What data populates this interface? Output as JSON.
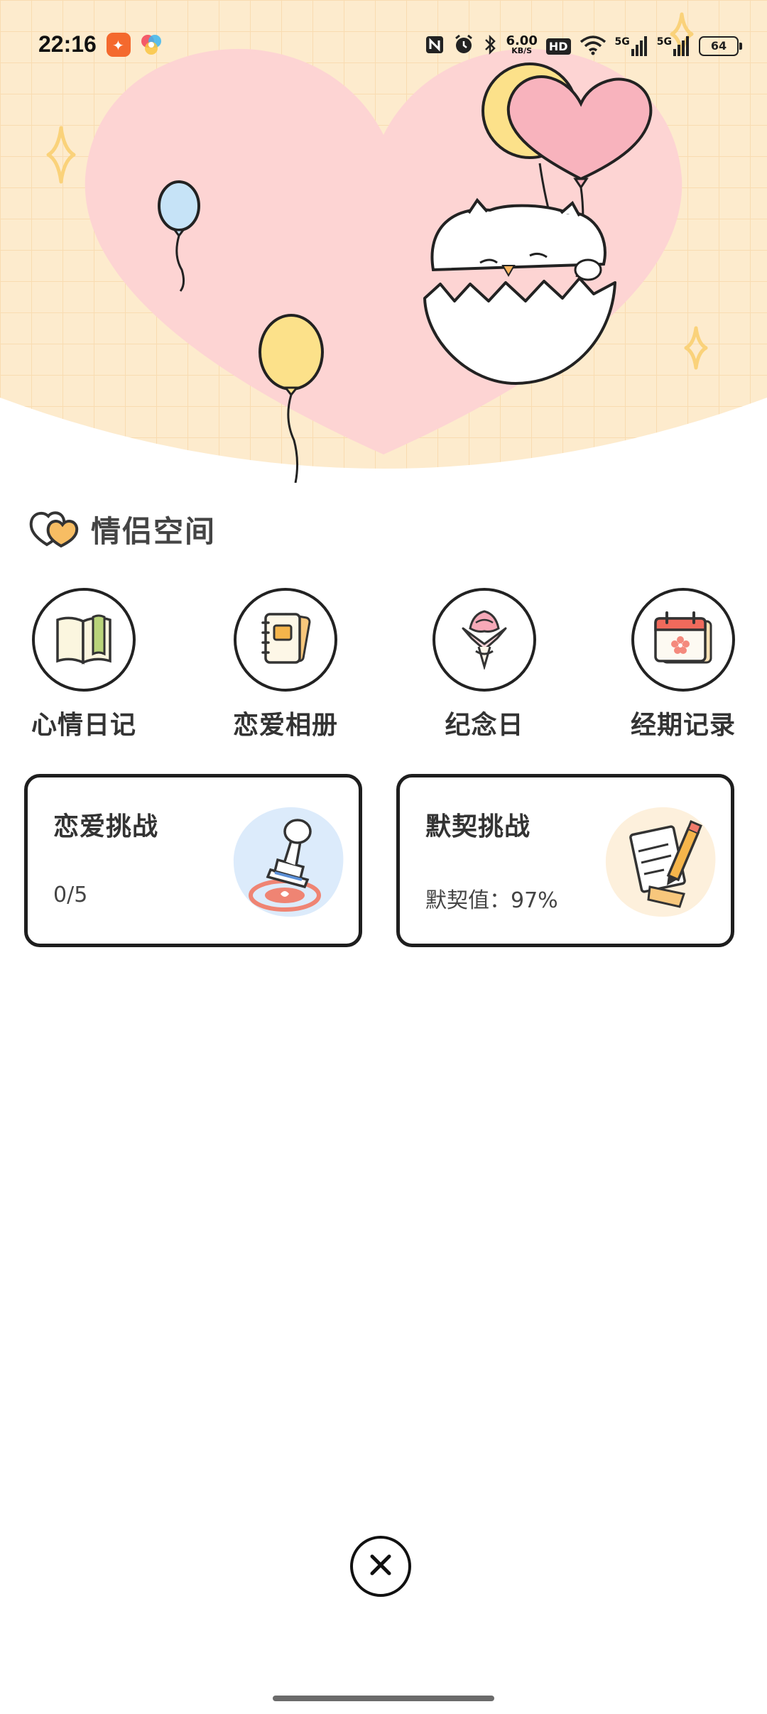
{
  "status_bar": {
    "time": "22:16",
    "network_speed": "6.00",
    "network_unit": "KB/S",
    "hd_badge": "HD",
    "signal1_label": "5G",
    "signal2_label": "5G",
    "battery": "64",
    "icons": [
      "app-orange-icon",
      "app-colorful-icon",
      "nfc-icon",
      "alarm-icon",
      "bluetooth-icon",
      "wifi-icon",
      "signal-icon",
      "battery-icon"
    ]
  },
  "section": {
    "title": "情侣空间",
    "icon": "double-heart-icon"
  },
  "features": [
    {
      "label": "心情日记",
      "icon": "diary-book-icon"
    },
    {
      "label": "恋爱相册",
      "icon": "photo-album-icon"
    },
    {
      "label": "纪念日",
      "icon": "bouquet-icon"
    },
    {
      "label": "经期记录",
      "icon": "calendar-flower-icon"
    }
  ],
  "cards": [
    {
      "title": "恋爱挑战",
      "subtitle": "0/5",
      "icon": "stamp-icon"
    },
    {
      "title": "默契挑战",
      "subtitle": "默契值：97%",
      "icon": "note-pencil-icon"
    }
  ],
  "colors": {
    "hero_bg": "#fde9c9",
    "heart": "#fcd2d2",
    "card_border": "#1e1e1e",
    "accent_yellow": "#fce18a",
    "accent_pink": "#f8b3bd",
    "accent_blue": "#c6e3f7"
  },
  "close_icon": "close-icon"
}
